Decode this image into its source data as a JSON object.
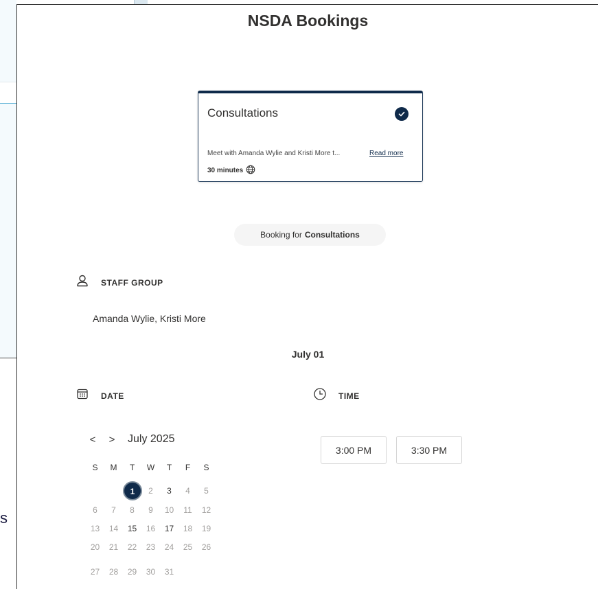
{
  "page": {
    "title": "NSDA Bookings"
  },
  "service": {
    "name": "Consultations",
    "description": "Meet with Amanda Wylie and Kristi More t...",
    "read_more": "Read more",
    "duration": "30 minutes",
    "selected": true
  },
  "booking_pill": {
    "prefix": "Booking for",
    "service": "Consultations"
  },
  "staff": {
    "label": "STAFF GROUP",
    "names": "Amanda Wylie, Kristi More"
  },
  "selected_date_label": "July 01",
  "date_section": {
    "label": "DATE"
  },
  "time_section": {
    "label": "TIME",
    "slots": [
      "3:00 PM",
      "3:30 PM"
    ]
  },
  "calendar": {
    "month": "July 2025",
    "prev": "<",
    "next": ">",
    "weekdays": [
      "S",
      "M",
      "T",
      "W",
      "T",
      "F",
      "S"
    ],
    "weeks": [
      [
        "",
        "",
        "1",
        "2",
        "3",
        "4",
        "5"
      ],
      [
        "6",
        "7",
        "8",
        "9",
        "10",
        "11",
        "12"
      ],
      [
        "13",
        "14",
        "15",
        "16",
        "17",
        "18",
        "19"
      ],
      [
        "20",
        "21",
        "22",
        "23",
        "24",
        "25",
        "26"
      ],
      [
        "27",
        "28",
        "29",
        "30",
        "31",
        "",
        ""
      ]
    ],
    "selected_day": "1",
    "available_days": [
      "1",
      "3",
      "15",
      "17"
    ]
  },
  "colors": {
    "accent": "#0f2a4a",
    "text": "#323130",
    "disabled": "#a19f9d"
  }
}
